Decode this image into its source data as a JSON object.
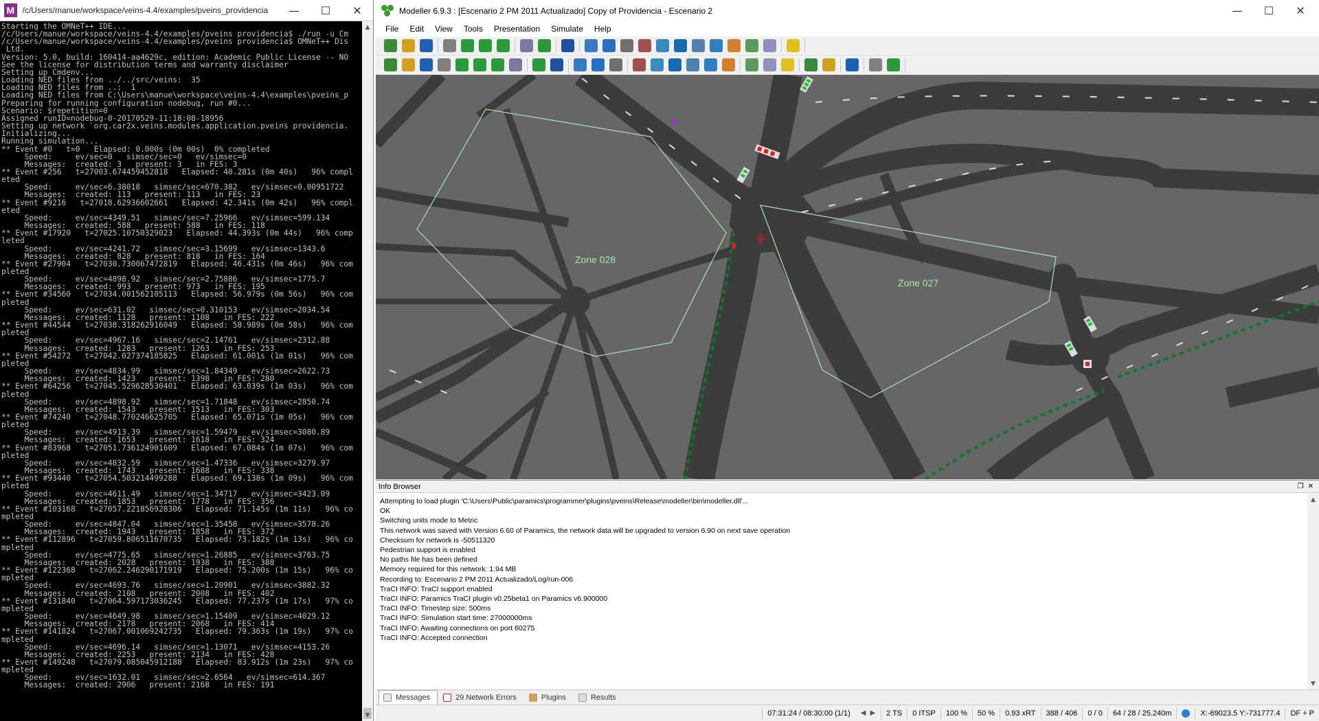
{
  "terminal": {
    "title": "/c/Users/manue/workspace/veins-4.4/examples/pveins_providencia",
    "lines": [
      "Starting the OMNeT++ IDE...",
      "",
      "/c/Users/manue/workspace/veins-4.4/examples/pveins_providencia$ ./run -u Cm",
      "",
      "/c/Users/manue/workspace/veins-4.4/examples/pveins_providencia$ OMNeT++ Dis",
      " Ltd.",
      "Version: 5.0, build: 160414-aa4629c, edition: Academic Public License -- NO",
      "See the license for distribution terms and warranty disclaimer",
      "Setting up Cmdenv...",
      "Loading NED files from ../../src/veins:  35",
      "Loading NED files from ..:  1",
      "Loading NED files from C:\\Users\\manue\\workspace\\veins-4.4\\examples\\pveins_p",
      "",
      "Preparing for running configuration nodebug, run #0...",
      "Scenario: $repetition=0",
      "Assigned runID=nodebug-0-20170529-11:18:08-18956",
      "Setting up network `org.car2x.veins.modules.application.pveins_providencia.",
      "Initializing...",
      "",
      "Running simulation...",
      "** Event #0   t=0   Elapsed: 0.000s (0m 00s)  0% completed",
      "     Speed:     ev/sec=0   simsec/sec=0   ev/simsec=0",
      "     Messages:  created: 3   present: 3   in FES: 3",
      "** Event #256   t=27003.674459452818   Elapsed: 40.281s (0m 40s)   96% compl",
      "eted",
      "     Speed:     ev/sec=6.38018   simsec/sec=670.382   ev/simsec=0.00951722",
      "     Messages:  created: 113   present: 113   in FES: 23",
      "** Event #9216   t=27018.62936602661   Elapsed: 42.341s (0m 42s)   96% compl",
      "eted",
      "     Speed:     ev/sec=4349.51   simsec/sec=7.25966   ev/simsec=599.134",
      "     Messages:  created: 588   present: 588   in FES: 118",
      "** Event #17920   t=27025.10750329023   Elapsed: 44.393s (0m 44s)   96% comp",
      "leted",
      "     Speed:     ev/sec=4241.72   simsec/sec=3.15699   ev/simsec=1343.6",
      "     Messages:  created: 828   present: 818   in FES: 164",
      "** Event #27904   t=27030.73006747281​9   Elapsed: 46.431s (0m 46s)   96% com",
      "pleted",
      "     Speed:     ev/sec=4898.92   simsec/sec=2.75886   ev/simsec=1775.7",
      "     Messages:  created: 993   present: 973   in FES: 195",
      "** Event #34560   t=27034.00156210511​3   Elapsed: 56.979s (0m 56s)   96% com",
      "pleted",
      "     Speed:     ev/sec=631.02   simsec/sec=0.310153   ev/simsec=2034.54",
      "     Messages:  created: 1128   present: 1108   in FES: 222",
      "** Event #44544   t=27038.318262916049   Elapsed: 58.989s (0m 58s)   96% com",
      "pleted",
      "     Speed:     ev/sec=4967.16   simsec/sec=2.14761   ev/simsec=2312.88",
      "     Messages:  created: 1283   present: 1263   in FES: 253",
      "** Event #54272   t=27042.02737418582​5   Elapsed: 61.001s (1m 01s)   96% com",
      "pleted",
      "     Speed:     ev/sec=4834.99   simsec/sec=1.84349   ev/simsec=2622.73",
      "     Messages:  created: 1423   present: 1398   in FES: 280",
      "** Event #64256   t=27045.529628530401   Elapsed: 63.039s (1m 03s)   96% com",
      "pleted",
      "     Speed:     ev/sec=4898.92   simsec/sec=1.71848   ev/simsec=2850.74",
      "     Messages:  created: 1543   present: 1513   in FES: 303",
      "** Event #74240   t=27048.770246625705   Elapsed: 65.071s (1m 05s)   96% com",
      "pleted",
      "     Speed:     ev/sec=4913.39   simsec/sec=1.59479   ev/simsec=3080.89",
      "     Messages:  created: 1653   present: 1618   in FES: 324",
      "** Event #83968   t=27051.736124901609   Elapsed: 67.084s (1m 07s)   96% com",
      "pleted",
      "     Speed:     ev/sec=4832.59   simsec/sec=1.47336   ev/simsec=3279.97",
      "     Messages:  created: 1743   present: 1688   in FES: 338",
      "** Event #93440   t=27054.503214499288   Elapsed: 69.138s (1m 09s)   96% com",
      "pleted",
      "     Speed:     ev/sec=4611.49   simsec/sec=1.34717   ev/simsec=3423.09",
      "     Messages:  created: 1853   present: 1778   in FES: 356",
      "** Event #103168   t=27057.221856928306   Elapsed: 71.145s (1m 11s)   96% co",
      "mpleted",
      "     Speed:     ev/sec=4847.04   simsec/sec=1.35458   ev/simsec=3578.26",
      "     Messages:  created: 1943   present: 1858   in FES: 372",
      "** Event #112896   t=27059.806511670735   Elapsed: 73.182s (1m 13s)   96% co",
      "mpleted",
      "     Speed:     ev/sec=4775.65   simsec/sec=1.26885   ev/simsec=3763.75",
      "     Messages:  created: 2028   present: 1938   in FES: 388",
      "** Event #122368   t=27062.246290171919   Elapsed: 75.200s (1m 15s)   96% co",
      "mpleted",
      "     Speed:     ev/sec=4693.76   simsec/sec=1.20901   ev/simsec=3882.32",
      "     Messages:  created: 2108   present: 2008   in FES: 402",
      "** Event #131840   t=27064.597173036245   Elapsed: 77.237s (1m 17s)   97% co",
      "mpleted",
      "     Speed:     ev/sec=4649.98   simsec/sec=1.15409   ev/simsec=4029.12",
      "     Messages:  created: 2178   present: 2068   in FES: 414",
      "** Event #141824   t=27067.001069242735   Elapsed: 79.363s (1m 19s)   97% co",
      "mpleted",
      "     Speed:     ev/sec=4696.14   simsec/sec=1.13071   ev/simsec=4153.26",
      "     Messages:  created: 2253   present: 2134   in FES: 428",
      "** Event #149248   t=27079.085045912188   Elapsed: 83.912s (1m 23s)   97% co",
      "mpleted",
      "     Speed:     ev/sec=1632.01   simsec/sec=2.6564   ev/simsec=614.367",
      "     Messages:  created: 2906   present: 2168   in FES: 191"
    ]
  },
  "modeller": {
    "title": "Modeller 6.9.3 : [Escenario 2 PM 2011 Actualizado] Copy of Providencia - Escenario 2",
    "menu": [
      "File",
      "Edit",
      "View",
      "Tools",
      "Presentation",
      "Simulate",
      "Help"
    ],
    "zones": [
      "Zone 028",
      "Zone 027"
    ],
    "info_browser": {
      "title": "Info Browser",
      "log": [
        "Attempting to load plugin 'C:\\Users\\Public\\paramics\\programmer\\plugins\\pveins\\Release\\modeller\\bin\\modeller.dll'...",
        " OK",
        "Switching units mode to Metric",
        "This network was saved with Version 6.60 of Paramics, the network data will be upgraded to version 6.90 on next save operation",
        "Checksum for network is -50511320",
        "Pedestrian support is enabled",
        "No paths file has been defined",
        "Memory required for this network: 1.94 MB",
        "Recording to: Escenario 2 PM 2011 Actualizado/Log/run-006",
        "TraCI INFO: TraCI support enabled",
        "TraCI INFO: Paramics TraCI plugin v0.25beta1 on Paramics v6.900000",
        "TraCI INFO: Timestep size: 500ms",
        "TraCI INFO: Simulation start time: 27000000ms",
        "TraCI INFO: Awaiting connections on port 60275",
        "TraCI INFO: Accepted connection"
      ],
      "tabs": [
        "Messages",
        "29 Network Errors",
        "Plugins",
        "Results"
      ]
    },
    "status": {
      "time": "07:31:24 / 08:30:00 (1/1)",
      "ts": "2 TS",
      "itsp": "0 ITSP",
      "pct1": "100 %",
      "pct2": "50 %",
      "xrt": "0.93 xRT",
      "count": "388 / 406",
      "zero": "0 / 0",
      "dist": "64 / 28 / 25.240m",
      "coords": "X:-69023.5  Y:-731777.4",
      "mode": "DF + P"
    },
    "colors": {
      "background": "#666666",
      "road": "#3c3c3c",
      "zone_outline": "#a8e6b0",
      "signal_green": "#22c02a",
      "signal_red": "#e02020",
      "accent": "#0a64c8"
    }
  }
}
